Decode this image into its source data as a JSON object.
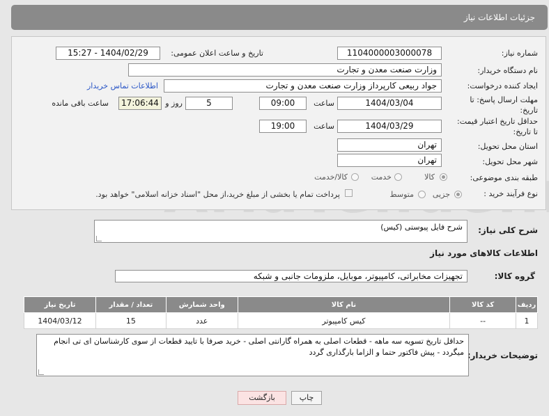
{
  "header": {
    "title": "جزئیات اطلاعات نیاز"
  },
  "form": {
    "need_number_label": "شماره نیاز:",
    "need_number": "1104000003000078",
    "announce_label": "تاریخ و ساعت اعلان عمومی:",
    "announce_value": "1404/02/29 - 15:27",
    "buyer_org_label": "نام دستگاه خریدار:",
    "buyer_org": "وزارت صنعت معدن و تجارت",
    "creator_label": "ایجاد کننده درخواست:",
    "creator": "جواد ربیعی کارپرداز وزارت صنعت معدن و تجارت",
    "contact_link": "اطلاعات تماس خریدار",
    "deadline_label_1": "مهلت ارسال پاسخ: تا",
    "deadline_label_2": "تاریخ:",
    "deadline_date": "1404/03/04",
    "time_label": "ساعت",
    "deadline_time": "09:00",
    "days_value": "5",
    "days_label": "روز و",
    "remaining_time": "17:06:44",
    "remaining_label": "ساعت باقی مانده",
    "validity_label_1": "حداقل تاریخ اعتبار قیمت:",
    "validity_label_2": "تا تاریخ:",
    "validity_date": "1404/03/29",
    "validity_time": "19:00",
    "province_label": "استان محل تحویل:",
    "province": "تهران",
    "city_label": "شهر محل تحویل:",
    "city": "تهران",
    "category_label": "طبقه بندی موضوعی:",
    "category_options": [
      "کالا",
      "خدمت",
      "کالا/خدمت"
    ],
    "category_selected": "کالا",
    "process_label": "نوع فرآیند خرید :",
    "process_options": [
      "جزیی",
      "متوسط"
    ],
    "process_selected": "جزیی",
    "payment_note": "پرداخت تمام یا بخشی از مبلغ خرید،از محل \"اسناد خزانه اسلامی\" خواهد بود."
  },
  "description": {
    "label": "شرح کلی نیاز:",
    "value": "شرح فایل پیوستی (کیس)"
  },
  "goods_section": {
    "title": "اطلاعات کالاهای مورد نیاز",
    "group_label": "گروه کالا:",
    "group_value": "تجهیزات مخابراتی، کامپیوتر، موبایل، ملزومات جانبی و شبکه"
  },
  "table": {
    "headers": [
      "ردیف",
      "کد کالا",
      "نام کالا",
      "واحد شمارش",
      "تعداد / مقدار",
      "تاریخ نیاز"
    ],
    "rows": [
      [
        "1",
        "--",
        "کیس کامپیوتر",
        "عدد",
        "15",
        "1404/03/12"
      ]
    ]
  },
  "buyer_notes": {
    "label": "توضیحات خریدار:",
    "value": "حداقل تاریخ تسویه سه ماهه - قطعات اصلی به همراه گارانتی اصلی - خرید صرفا با تایید قطعات از سوی کارشناسان ای تی انجام میگردد - پیش فاکتور حتما و الزاما بارگذاری گردد"
  },
  "buttons": {
    "print": "چاپ",
    "back": "بازگشت"
  },
  "watermark": {
    "text": "AriaTender.net"
  }
}
